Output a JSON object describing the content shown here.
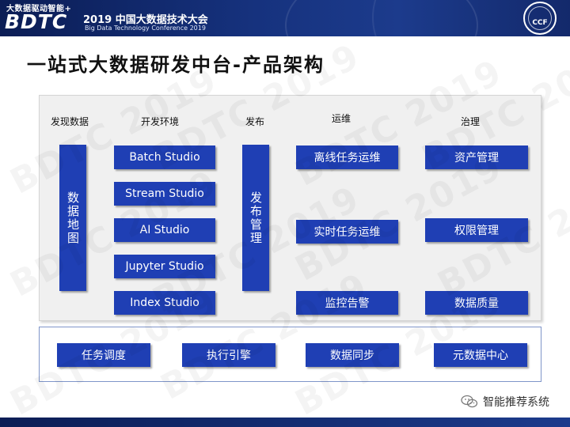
{
  "banner": {
    "tagline": "大数据驱动智能+",
    "logo_text": "BDTC",
    "conference_cn": "2019 中国大数据技术大会",
    "conference_en": "Big Data Technology Conference 2019",
    "seal_text": "CCF"
  },
  "title": "一站式大数据研发中台-产品架构",
  "watermark": "BDTC 2019",
  "columns": {
    "discover": "发现数据",
    "develop": "开发环境",
    "publish": "发布",
    "operate": "运维",
    "govern": "治理"
  },
  "data_map": "数据地图",
  "dev_studios": [
    "Batch Studio",
    "Stream Studio",
    "AI Studio",
    "Jupyter Studio",
    "Index Studio"
  ],
  "publish_manage": "发布管理",
  "ops_items": [
    "离线任务运维",
    "实时任务运维",
    "监控告警"
  ],
  "gov_items": [
    "资产管理",
    "权限管理",
    "数据质量"
  ],
  "bottom_items": [
    "任务调度",
    "执行引擎",
    "数据同步",
    "元数据中心"
  ],
  "footer": {
    "brand": "智能推荐系统"
  },
  "colors": {
    "box_blue": "#1f3fb4",
    "banner_navy": "#0b1d55",
    "panel_gray": "#f0f0f0"
  }
}
